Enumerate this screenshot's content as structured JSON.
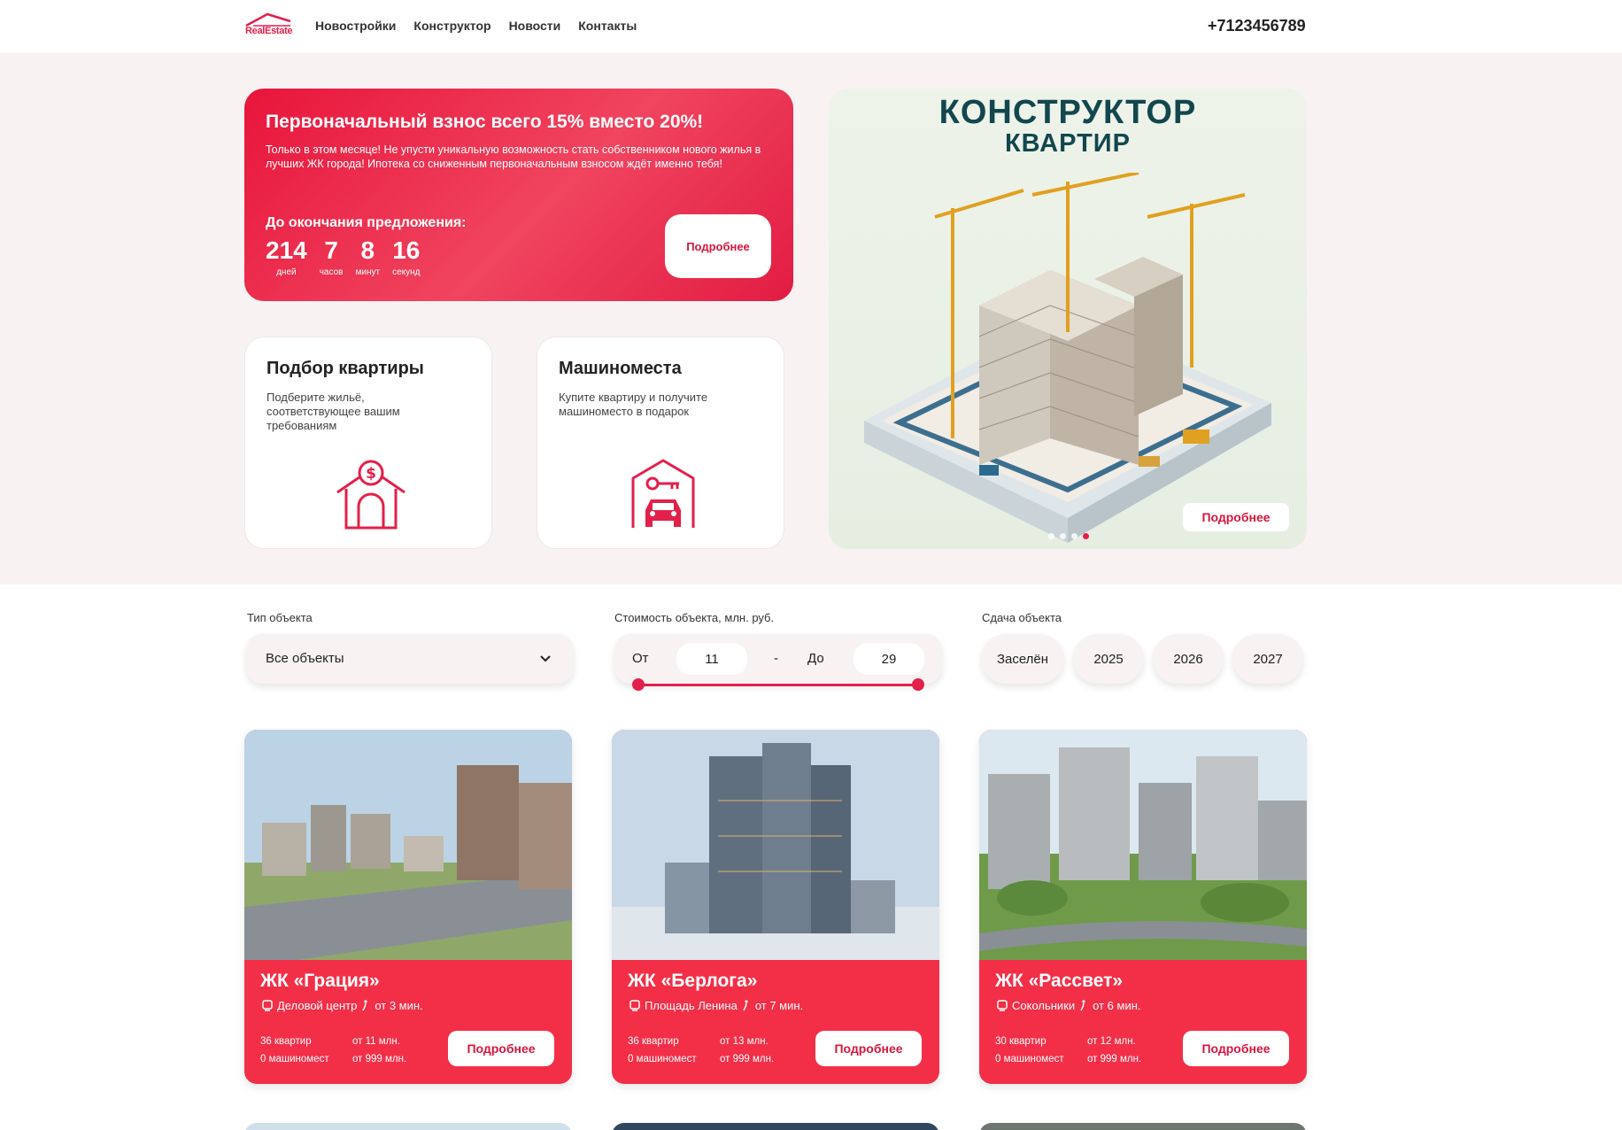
{
  "header": {
    "logo_text": "RealEstate",
    "nav": [
      "Новостройки",
      "Конструктор",
      "Новости",
      "Контакты"
    ],
    "phone": "+7123456789"
  },
  "promo": {
    "title": "Первоначальный взнос всего 15% вместо 20%!",
    "text": "Только в этом месяце! Не упусти уникальную возможность стать собственником нового жилья в лучших ЖК города! Ипотека со сниженным первоначальным взносом ждёт именно тебя!",
    "until_label": "До окончания предложения:",
    "countdown": [
      {
        "value": "214",
        "label": "дней"
      },
      {
        "value": "7",
        "label": "часов"
      },
      {
        "value": "8",
        "label": "минут"
      },
      {
        "value": "16",
        "label": "секунд"
      }
    ],
    "button": "Подробнее"
  },
  "tiles": [
    {
      "title": "Подбор квартиры",
      "desc": "Подберите жильё, соответствующее вашим требованиям",
      "icon": "house-dollar-icon"
    },
    {
      "title": "Машиноместа",
      "desc": "Купите квартиру и получите машиноместо в подарок",
      "icon": "garage-car-key-icon"
    }
  ],
  "banner": {
    "title": "КОНСТРУКТОР",
    "subtitle": "КВАРТИР",
    "button": "Подробнее",
    "slides": 4,
    "active_slide": 4
  },
  "filters": {
    "type_label": "Тип объекта",
    "type_value": "Все объекты",
    "price_label": "Стоимость объекта, млн. руб.",
    "from_label": "От",
    "from_value": "11",
    "dash": "-",
    "to_label": "До",
    "to_value": "29",
    "delivery_label": "Сдача объекта",
    "delivery_options": [
      "Заселён",
      "2025",
      "2026",
      "2027"
    ]
  },
  "complexes": [
    {
      "name": "ЖК «Грация»",
      "station": "Деловой центр",
      "walk": "от 3 мин.",
      "flats": "36 квартир",
      "parking": "0 машиномест",
      "price_flat": "от 11 млн.",
      "price_parking": "от 999 млн.",
      "button": "Подробнее"
    },
    {
      "name": "ЖК «Берлога»",
      "station": "Площадь Ленина",
      "walk": "от 7 мин.",
      "flats": "36 квартир",
      "parking": "0 машиномест",
      "price_flat": "от 13 млн.",
      "price_parking": "от 999 млн.",
      "button": "Подробнее"
    },
    {
      "name": "ЖК «Рассвет»",
      "station": "Сокольники",
      "walk": "от 6 мин.",
      "flats": "30 квартир",
      "parking": "0 машиномест",
      "price_flat": "от 12 млн.",
      "price_parking": "от 999 млн.",
      "button": "Подробнее"
    }
  ],
  "colors": {
    "accent": "#e3204a",
    "card_red": "#f32f48",
    "hero_bg": "#f8f2f2",
    "banner_title": "#12474e"
  }
}
